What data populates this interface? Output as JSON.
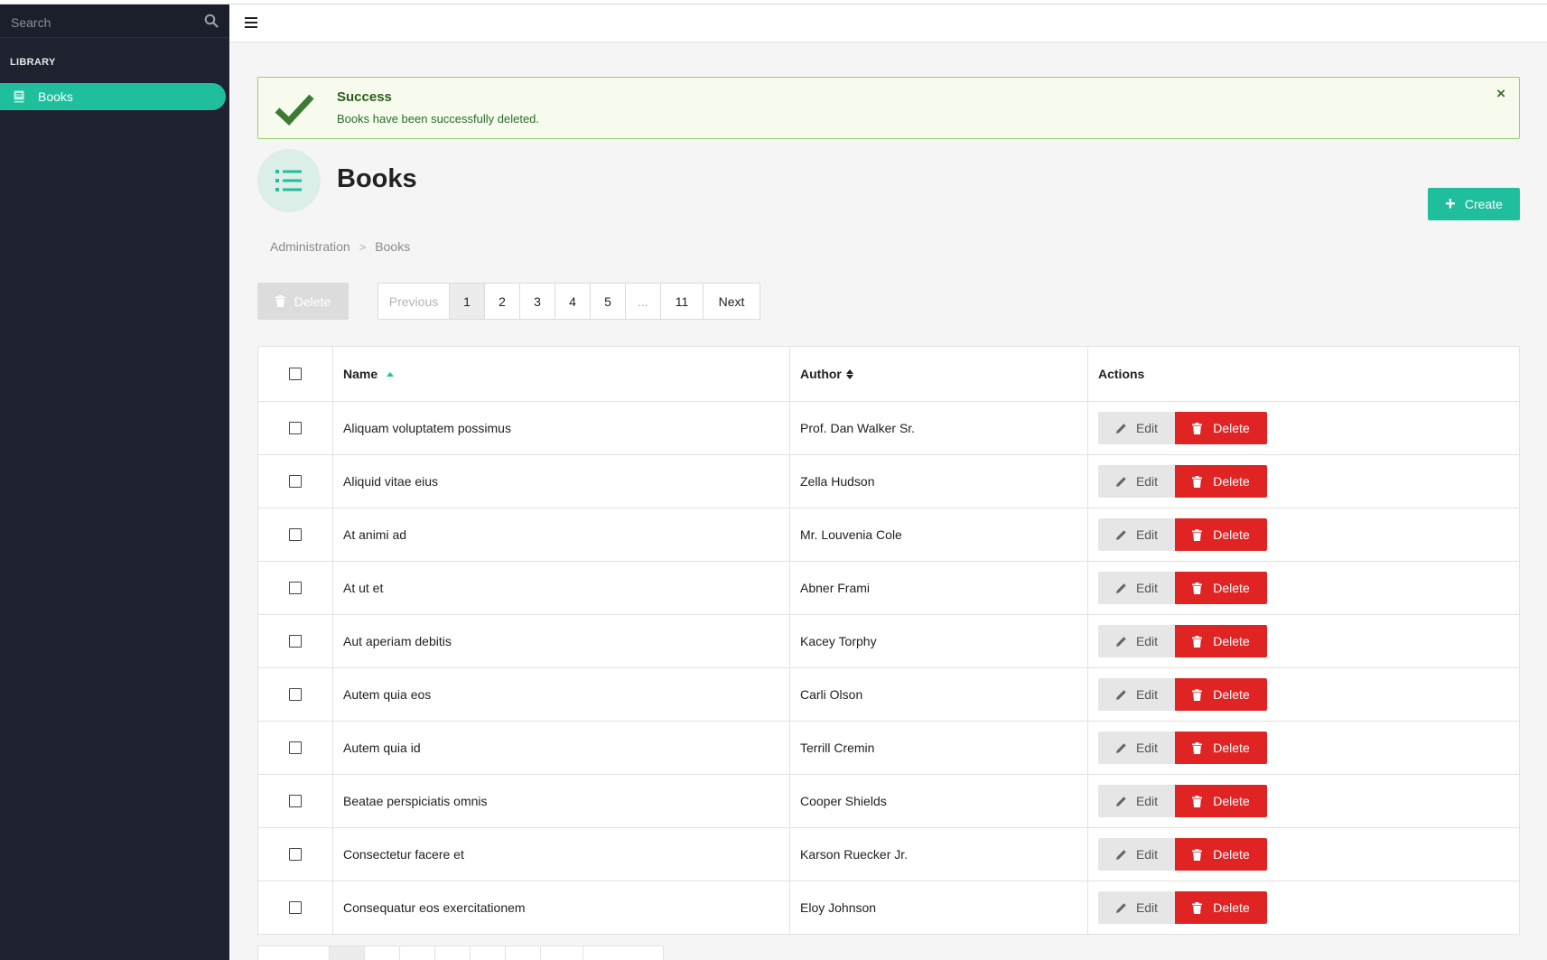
{
  "sidebar": {
    "search_placeholder": "Search",
    "section_label": "LIBRARY",
    "items": [
      {
        "label": "Books",
        "icon": "book-icon",
        "active": true
      }
    ]
  },
  "colors": {
    "accent": "#1fbf9e",
    "danger": "#e02424",
    "sidebar": "#1e2130"
  },
  "alert": {
    "title": "Success",
    "message": "Books have been successfully deleted.",
    "close": "×"
  },
  "page": {
    "title": "Books",
    "create_label": "Create"
  },
  "breadcrumb": [
    "Administration",
    "Books"
  ],
  "toolbar": {
    "bulk_delete_label": "Delete"
  },
  "pagination": {
    "previous": "Previous",
    "pages": [
      "1",
      "2",
      "3",
      "4",
      "5",
      "...",
      "11"
    ],
    "next": "Next",
    "current": "1"
  },
  "table": {
    "columns": {
      "name": "Name",
      "author": "Author",
      "actions": "Actions"
    },
    "sort": {
      "column": "Name",
      "direction": "asc"
    },
    "edit_label": "Edit",
    "delete_label": "Delete",
    "rows": [
      {
        "name": "Aliquam voluptatem possimus",
        "author": "Prof. Dan Walker Sr."
      },
      {
        "name": "Aliquid vitae eius",
        "author": "Zella Hudson"
      },
      {
        "name": "At animi ad",
        "author": "Mr. Louvenia Cole"
      },
      {
        "name": "At ut et",
        "author": "Abner Frami"
      },
      {
        "name": "Aut aperiam debitis",
        "author": "Kacey Torphy"
      },
      {
        "name": "Autem quia eos",
        "author": "Carli Olson"
      },
      {
        "name": "Autem quia id",
        "author": "Terrill Cremin"
      },
      {
        "name": "Beatae perspiciatis omnis",
        "author": "Cooper Shields"
      },
      {
        "name": "Consectetur facere et",
        "author": "Karson Ruecker Jr."
      },
      {
        "name": "Consequatur eos exercitationem",
        "author": "Eloy Johnson"
      }
    ]
  }
}
